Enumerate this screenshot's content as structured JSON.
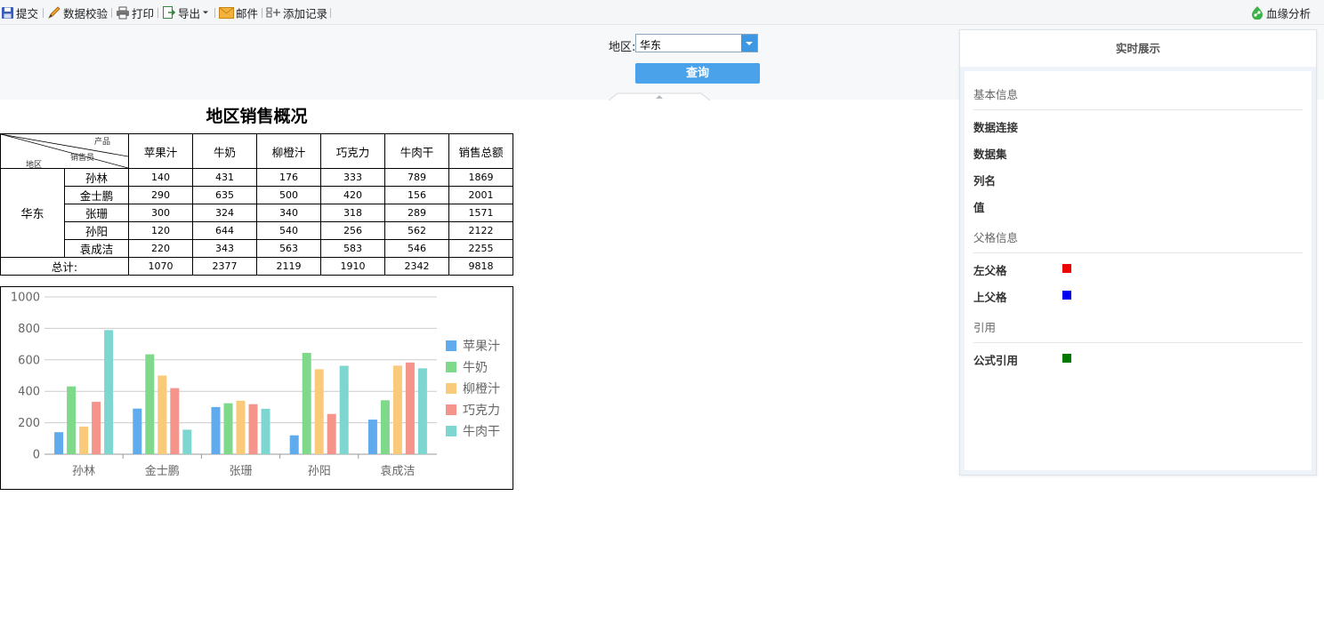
{
  "toolbar": {
    "items": [
      "提交",
      "数据校验",
      "打印",
      "导出",
      "邮件",
      "添加记录"
    ],
    "lineage": "血缘分析"
  },
  "params": {
    "region_label": "地区:",
    "region_value": "华东",
    "query_label": "查询"
  },
  "report": {
    "title": "地区销售概况",
    "corner": {
      "product": "产品",
      "salesperson": "销售员",
      "region": "地区"
    },
    "columns": [
      "苹果汁",
      "牛奶",
      "柳橙汁",
      "巧克力",
      "牛肉干",
      "销售总额"
    ],
    "region": "华东",
    "rows": [
      {
        "name": "孙林",
        "values": [
          "140",
          "431",
          "176",
          "333",
          "789",
          "1869"
        ]
      },
      {
        "name": "金士鹏",
        "values": [
          "290",
          "635",
          "500",
          "420",
          "156",
          "2001"
        ]
      },
      {
        "name": "张珊",
        "values": [
          "300",
          "324",
          "340",
          "318",
          "289",
          "1571"
        ]
      },
      {
        "name": "孙阳",
        "values": [
          "120",
          "644",
          "540",
          "256",
          "562",
          "2122"
        ]
      },
      {
        "name": "袁成洁",
        "values": [
          "220",
          "343",
          "563",
          "583",
          "546",
          "2255"
        ]
      }
    ],
    "total_label": "总计:",
    "totals": [
      "1070",
      "2377",
      "2119",
      "1910",
      "2342",
      "9818"
    ]
  },
  "chart_data": {
    "type": "bar",
    "categories": [
      "孙林",
      "金士鹏",
      "张珊",
      "孙阳",
      "袁成洁"
    ],
    "series": [
      {
        "name": "苹果汁",
        "color": "#5fabed",
        "values": [
          140,
          290,
          300,
          120,
          220
        ]
      },
      {
        "name": "牛奶",
        "color": "#7fd98a",
        "values": [
          431,
          635,
          324,
          644,
          343
        ]
      },
      {
        "name": "柳橙汁",
        "color": "#f9ca7a",
        "values": [
          176,
          500,
          340,
          540,
          563
        ]
      },
      {
        "name": "巧克力",
        "color": "#f5948a",
        "values": [
          333,
          420,
          318,
          256,
          583
        ]
      },
      {
        "name": "牛肉干",
        "color": "#7dd6d0",
        "values": [
          789,
          156,
          289,
          562,
          546
        ]
      }
    ],
    "yticks": [
      "0",
      "200",
      "400",
      "600",
      "800",
      "1000"
    ],
    "ylim": [
      0,
      1000
    ],
    "grid": true,
    "legend": "right"
  },
  "panel": {
    "title": "实时展示",
    "basic_section": "基本信息",
    "basic_fields": [
      "数据连接",
      "数据集",
      "列名",
      "值"
    ],
    "parent_section": "父格信息",
    "left_parent": "左父格",
    "top_parent": "上父格",
    "ref_section": "引用",
    "formula_ref": "公式引用",
    "colors": {
      "left_parent": "#ee0000",
      "top_parent": "#0000ee",
      "formula_ref": "#007700"
    }
  }
}
